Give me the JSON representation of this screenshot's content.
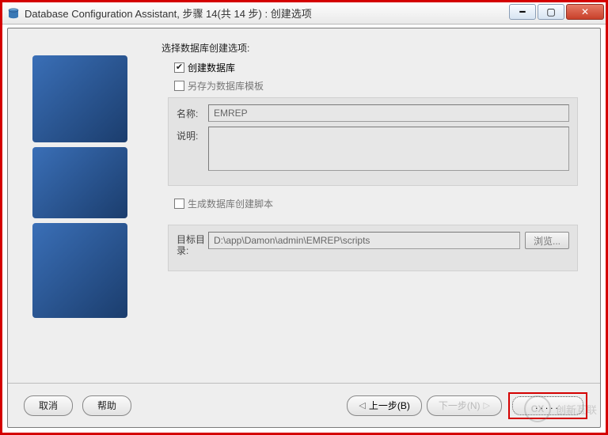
{
  "window": {
    "title": "Database Configuration Assistant, 步骤 14(共 14 步) : 创建选项"
  },
  "main": {
    "section_title": "选择数据库创建选项:",
    "create_db": {
      "label": "创建数据库",
      "checked": true
    },
    "save_template": {
      "label": "另存为数据库模板",
      "checked": false,
      "name_label": "名称:",
      "name_value": "EMREP",
      "desc_label": "说明:",
      "desc_value": ""
    },
    "gen_scripts": {
      "label": "生成数据库创建脚本",
      "checked": false,
      "dest_label": "目标目录:",
      "dest_value": "D:\\app\\Damon\\admin\\EMREP\\scripts",
      "browse_label": "浏览..."
    }
  },
  "footer": {
    "cancel": "取消",
    "help": "帮助",
    "back": "上一步(B)",
    "next": "下一步(N)",
    "finish": "....."
  }
}
